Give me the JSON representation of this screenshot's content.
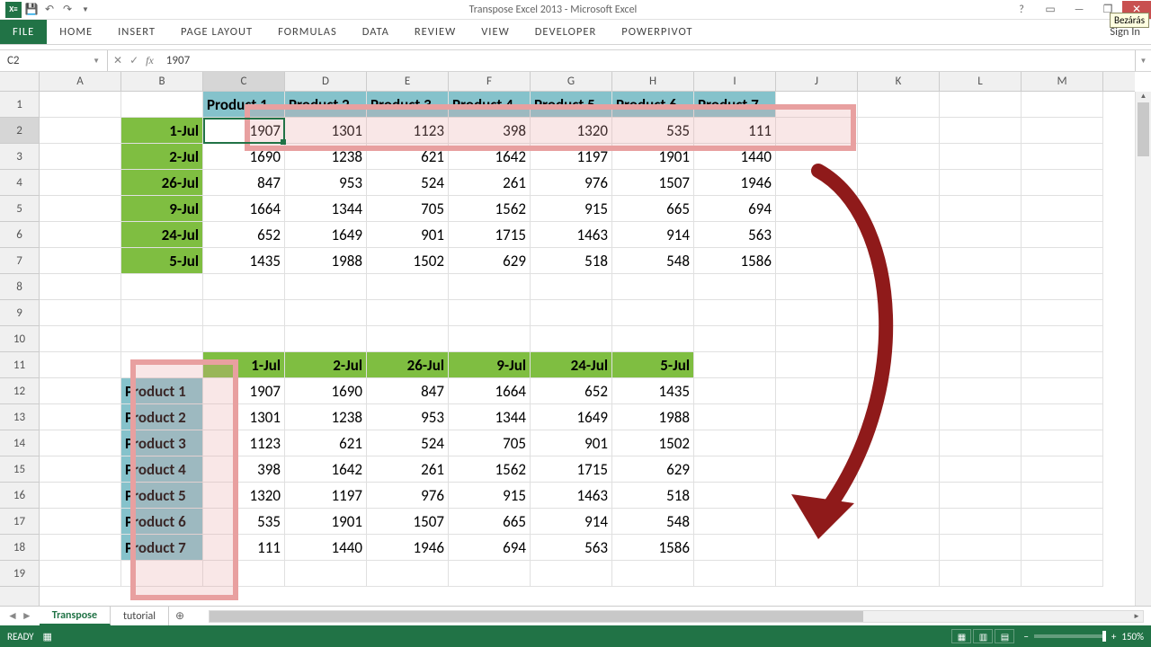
{
  "title": "Transpose Excel 2013 - Microsoft Excel",
  "tooltip": "Bezárás",
  "qat": {
    "save": "💾",
    "undo": "↶",
    "redo": "↷"
  },
  "tabs": [
    "FILE",
    "HOME",
    "INSERT",
    "PAGE LAYOUT",
    "FORMULAS",
    "DATA",
    "REVIEW",
    "VIEW",
    "DEVELOPER",
    "POWERPIVOT"
  ],
  "signin": "Sign In",
  "namebox": "C2",
  "formula": "1907",
  "columns": [
    "A",
    "B",
    "C",
    "D",
    "E",
    "F",
    "G",
    "H",
    "I",
    "J",
    "K",
    "L",
    "M"
  ],
  "rows": [
    1,
    2,
    3,
    4,
    5,
    6,
    7,
    8,
    9,
    10,
    11,
    12,
    13,
    14,
    15,
    16,
    17,
    18,
    19
  ],
  "activeCol": "C",
  "activeRow": 2,
  "table1": {
    "headers": [
      "Product 1",
      "Product 2",
      "Product 3",
      "Product 4",
      "Product 5",
      "Product 6",
      "Product 7"
    ],
    "dates": [
      "1-Jul",
      "2-Jul",
      "26-Jul",
      "9-Jul",
      "24-Jul",
      "5-Jul"
    ],
    "data": [
      [
        1907,
        1301,
        1123,
        398,
        1320,
        535,
        111
      ],
      [
        1690,
        1238,
        621,
        1642,
        1197,
        1901,
        1440
      ],
      [
        847,
        953,
        524,
        261,
        976,
        1507,
        1946
      ],
      [
        1664,
        1344,
        705,
        1562,
        915,
        665,
        694
      ],
      [
        652,
        1649,
        901,
        1715,
        1463,
        914,
        563
      ],
      [
        1435,
        1988,
        1502,
        629,
        518,
        548,
        1586
      ]
    ]
  },
  "table2": {
    "headers": [
      "1-Jul",
      "2-Jul",
      "26-Jul",
      "9-Jul",
      "24-Jul",
      "5-Jul"
    ],
    "labels": [
      "Product 1",
      "Product 2",
      "Product 3",
      "Product 4",
      "Product 5",
      "Product 6",
      "Product 7"
    ],
    "data": [
      [
        1907,
        1690,
        847,
        1664,
        652,
        1435
      ],
      [
        1301,
        1238,
        953,
        1344,
        1649,
        1988
      ],
      [
        1123,
        621,
        524,
        705,
        901,
        1502
      ],
      [
        398,
        1642,
        261,
        1562,
        1715,
        629
      ],
      [
        1320,
        1197,
        976,
        915,
        1463,
        518
      ],
      [
        535,
        1901,
        1507,
        665,
        914,
        548
      ],
      [
        111,
        1440,
        1946,
        694,
        563,
        1586
      ]
    ]
  },
  "sheets": {
    "active": "Transpose",
    "other": "tutorial"
  },
  "status": {
    "ready": "READY",
    "zoom": "150%"
  },
  "wctrls": {
    "help": "?",
    "full": "▭",
    "min": "—",
    "restore": "❐",
    "close": "✕"
  }
}
